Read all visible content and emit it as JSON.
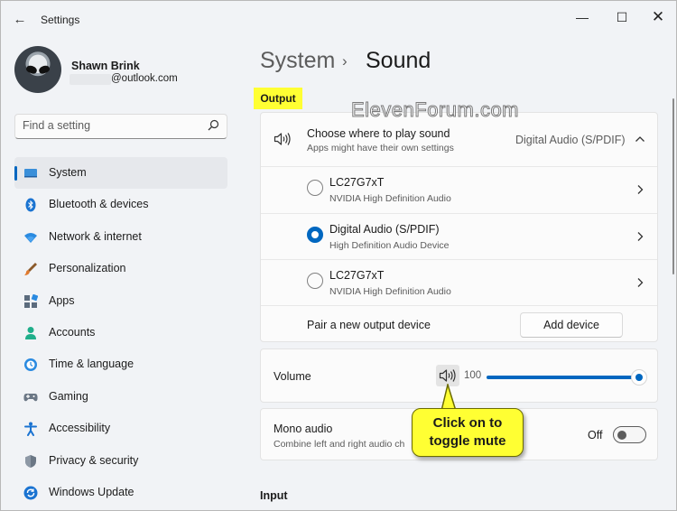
{
  "window": {
    "app_title": "Settings",
    "back_glyph": "←",
    "min_glyph": "—",
    "max_glyph": "☐",
    "close_glyph": "✕"
  },
  "user": {
    "name": "Shawn Brink",
    "email": "@outlook.com"
  },
  "search": {
    "placeholder": "Find a setting",
    "icon": "search-icon"
  },
  "sidebar": {
    "items": [
      {
        "label": "System",
        "icon": "monitor-icon",
        "active": true
      },
      {
        "label": "Bluetooth & devices",
        "icon": "bluetooth-icon"
      },
      {
        "label": "Network & internet",
        "icon": "wifi-icon"
      },
      {
        "label": "Personalization",
        "icon": "brush-icon"
      },
      {
        "label": "Apps",
        "icon": "apps-icon"
      },
      {
        "label": "Accounts",
        "icon": "person-icon"
      },
      {
        "label": "Time & language",
        "icon": "clock-globe-icon"
      },
      {
        "label": "Gaming",
        "icon": "gamepad-icon"
      },
      {
        "label": "Accessibility",
        "icon": "accessibility-icon"
      },
      {
        "label": "Privacy & security",
        "icon": "shield-icon"
      },
      {
        "label": "Windows Update",
        "icon": "update-icon"
      }
    ]
  },
  "breadcrumb": {
    "parent": "System",
    "separator": "›",
    "current": "Sound"
  },
  "watermark": "ElevenForum.com",
  "output": {
    "section_label": "Output",
    "choose": {
      "title": "Choose where to play sound",
      "subtitle": "Apps might have their own settings",
      "value": "Digital Audio (S/PDIF)",
      "expanded": true
    },
    "devices": [
      {
        "name": "LC27G7xT",
        "sub": "NVIDIA High Definition Audio",
        "selected": false
      },
      {
        "name": "Digital Audio (S/PDIF)",
        "sub": "High Definition Audio Device",
        "selected": true
      },
      {
        "name": "LC27G7xT",
        "sub": "NVIDIA High Definition Audio",
        "selected": false
      }
    ],
    "pair_label": "Pair a new output device",
    "add_device_label": "Add device"
  },
  "volume": {
    "label": "Volume",
    "value": "100",
    "level": 1.0
  },
  "mono": {
    "title": "Mono audio",
    "subtitle": "Combine left and right audio ch",
    "state": "Off"
  },
  "callout": {
    "line1": "Click on to",
    "line2": "toggle mute"
  },
  "input": {
    "section_label": "Input"
  },
  "colors": {
    "accent": "#0067c0",
    "highlight": "#ffff33",
    "window_bg": "#f1f3f6",
    "card_bg": "#fbfbfb"
  }
}
